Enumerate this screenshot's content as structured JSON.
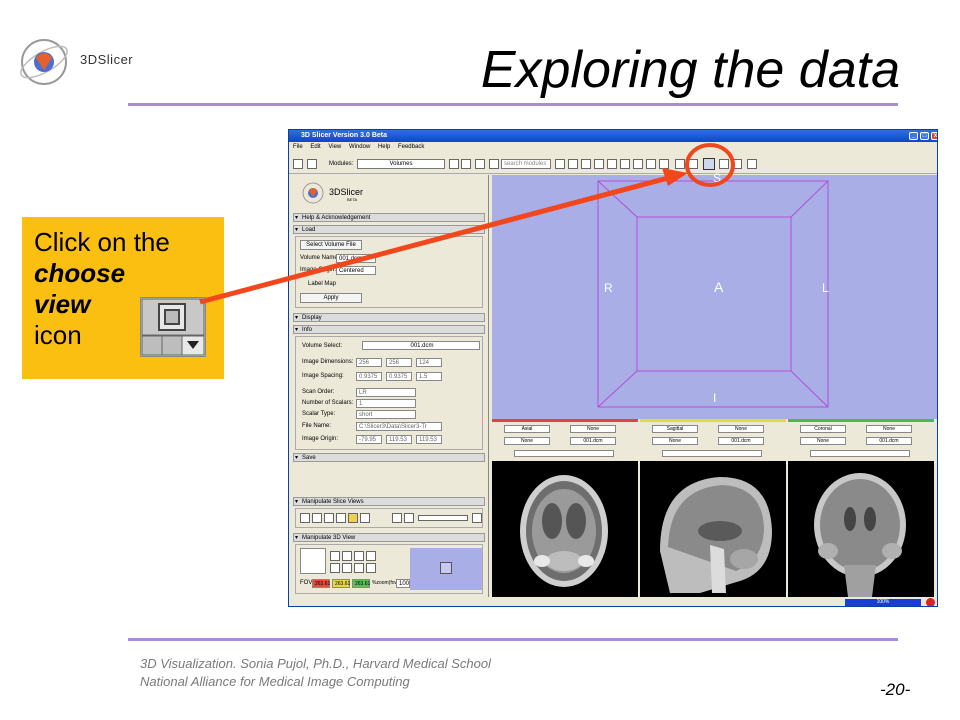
{
  "slide": {
    "title": "Exploring the data",
    "logo_text": "3DSlicer",
    "footer_line1": "3D Visualization. Sonia Pujol, Ph.D., Harvard Medical School",
    "footer_line2": "National Alliance for Medical Image Computing",
    "page_number": "-20-"
  },
  "callout": {
    "line1": "Click on the",
    "line2": "choose",
    "line3": "view",
    "line4": "icon"
  },
  "app": {
    "window_title": "3D Slicer Version 3.0 Beta",
    "menu": [
      "File",
      "Edit",
      "View",
      "Window",
      "Help",
      "Feedback"
    ],
    "modules_label": "Modules:",
    "modules_value": "Volumes",
    "search_placeholder": "search modules",
    "logo_small": "3DSlicer",
    "logo_small_sub": "BETA",
    "sections": {
      "help": "Help & Acknowledgement",
      "load": "Load",
      "display": "Display",
      "info": "Info",
      "save": "Save",
      "manipulate_slice": "Manipulate Slice Views",
      "manipulate_3d": "Manipulate 3D View"
    },
    "load": {
      "select_button": "Select Volume File",
      "volume_name_label": "Volume Name:",
      "volume_name_value": "001.dcm",
      "image_origin_label": "Image Origin:",
      "image_origin_value": "Centered",
      "label_map": "Label Map",
      "apply": "Apply"
    },
    "info": {
      "volume_select_label": "Volume Select:",
      "volume_select_value": "001.dcm",
      "dimensions_label": "Image Dimensions:",
      "dimensions": [
        "256",
        "256",
        "124"
      ],
      "spacing_label": "Image Spacing:",
      "spacing": [
        "0.9375",
        "0.9375",
        "1.5"
      ],
      "scan_order_label": "Scan Order:",
      "scan_order": "LR",
      "num_scalars_label": "Number of Scalars:",
      "num_scalars": "1",
      "scalar_type_label": "Scalar Type:",
      "scalar_type": "short",
      "file_name_label": "File Name:",
      "file_name": "C:\\Slicer3\\Data\\Slicer3-Tr",
      "origin_label": "Image Origin:",
      "origin": [
        "-79.95",
        "119.53",
        "119.53"
      ]
    },
    "view3d": {
      "labels": {
        "S": "S",
        "R": "R",
        "A": "A",
        "L": "L",
        "I": "I"
      }
    },
    "slices": [
      {
        "orientation": "Axial",
        "fg": "None",
        "bg": "None",
        "lbl": "001.dcm",
        "color": "#e0443a"
      },
      {
        "orientation": "Sagittal",
        "fg": "None",
        "bg": "None",
        "lbl": "001.dcm",
        "color": "#e8d840"
      },
      {
        "orientation": "Coronal",
        "fg": "None",
        "bg": "None",
        "lbl": "001.dcm",
        "color": "#4fb849"
      }
    ],
    "manip3d": {
      "fov_label": "FOV:",
      "fov_values": [
        "263.61",
        "263.61",
        "263.61"
      ],
      "zoom_label": "%zoom(fov):",
      "zoom_value": "100"
    },
    "status": {
      "progress": "100%"
    }
  }
}
